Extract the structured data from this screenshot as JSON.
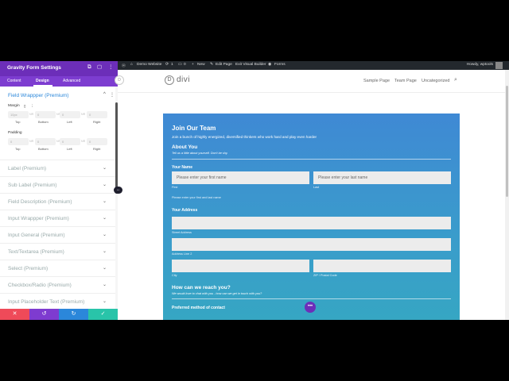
{
  "panel": {
    "title": "Gravity Form Settings",
    "header_icons": [
      "⧉",
      "▢",
      "⋮"
    ],
    "tabs": [
      "Content",
      "Design",
      "Advanced"
    ],
    "active_tab": "Design",
    "open_section": {
      "title": "Field Wrappper (Premium)",
      "margin_label": "Margin",
      "padding_label": "Padding",
      "margin_placeholders": [
        "10px",
        "0",
        "0",
        "0"
      ],
      "padding_placeholders": [
        "0",
        "0",
        "0",
        "0"
      ],
      "units": [
        "NR",
        "NR",
        "NR",
        "NR"
      ],
      "side_labels": [
        "Top",
        "Bottom",
        "Left",
        "Right"
      ]
    },
    "sections": [
      "Label (Premium)",
      "Sub Label (Premium)",
      "Field Description (Premium)",
      "Input Wrappper (Premium)",
      "Input General (Premium)",
      "Text/Textarea (Premium)",
      "Select (Premium)",
      "Checkbox/Radio (Premium)",
      "Input Placeholder Text (Premium)"
    ],
    "bottom_buttons": [
      {
        "icon": "✕",
        "color": "#ef4a59"
      },
      {
        "icon": "↺",
        "color": "#7e3bd0"
      },
      {
        "icon": "↻",
        "color": "#2b87da"
      },
      {
        "icon": "✓",
        "color": "#29c4a9"
      }
    ]
  },
  "adminbar": {
    "site_name": "Demo Website",
    "updates": "1",
    "comments": "0",
    "new": "New",
    "edit_page": "Edit Page",
    "exit_vb": "Exit Visual Builder",
    "forms": "Forms",
    "howdy": "Howdy, wptools"
  },
  "site": {
    "logo": "divi",
    "nav": [
      "Sample Page",
      "Team Page",
      "Uncategorized"
    ]
  },
  "form": {
    "title": "Join Our Team",
    "description": "Join a bunch of highly energized, diversified thinkers who work hard and play even harder",
    "section1_title": "About You",
    "section1_desc": "Tell us a little about yourself. Don't be shy.",
    "name_label": "Your Name",
    "first_placeholder": "Please enter your first name",
    "last_placeholder": "Please enter your last name",
    "first_cap": "First",
    "last_cap": "Last",
    "name_help": "Please enter your first and last name",
    "address_label": "Your Address",
    "street_cap": "Street Address",
    "line2_cap": "Address Line 2",
    "city_cap": "City",
    "zip_cap": "ZIP / Postal Code",
    "section2_title": "How can we reach you?",
    "section2_desc": "We would love to chat with you - how can we get in touch with you?",
    "contact_label": "Preferred method of contact"
  }
}
